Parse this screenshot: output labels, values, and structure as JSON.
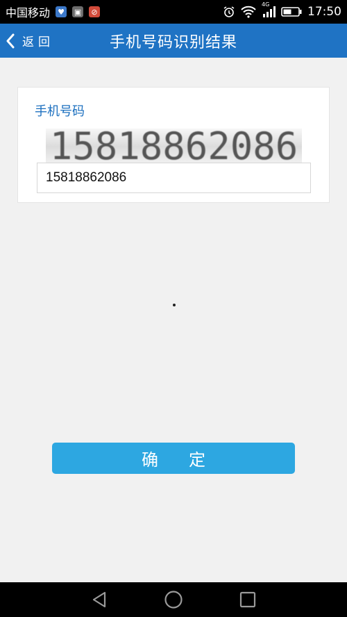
{
  "status_bar": {
    "carrier": "中国移动",
    "network": "4G",
    "time": "17:50"
  },
  "nav": {
    "back_label": "返回",
    "title": "手机号码识别结果"
  },
  "result": {
    "field_label": "手机号码",
    "recognized_image_text": "15818862086",
    "phone_value": "15818862086"
  },
  "confirm_label": "确定",
  "colors": {
    "nav_bar": "#1f73c4",
    "label": "#1b6fbf",
    "confirm_button": "#2da7e1",
    "background": "#f1f1f1"
  },
  "icons": {
    "status": [
      "notification-app-icon",
      "notification-image-icon",
      "notification-blocked-icon",
      "alarm-icon",
      "wifi-icon",
      "signal-icon",
      "battery-icon"
    ],
    "system_nav": [
      "back-triangle-icon",
      "home-circle-icon",
      "recents-square-icon"
    ]
  }
}
